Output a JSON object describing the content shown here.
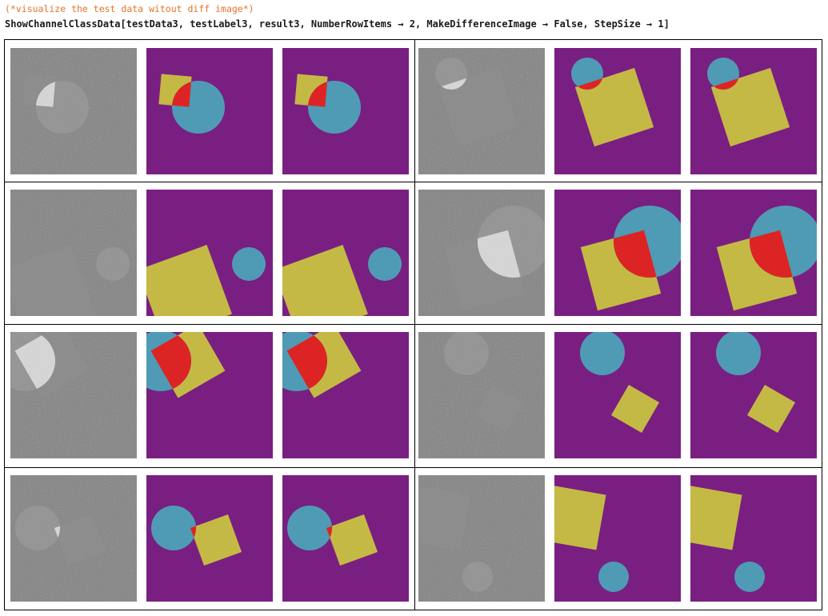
{
  "notebook": {
    "comment": "(*visualize the test data witout diff image*)",
    "code": "ShowChannelClassData[testData3, testLabel3, result3, NumberRowItems → 2, MakeDifferenceImage → False, StepSize → 1]"
  },
  "colors": {
    "background": "#7a1f82",
    "square": "#c4b944",
    "circle": "#4f9bb5",
    "overlap": "#dd2424",
    "noise_dark": "#2a2a2a",
    "gray_shape": "#8c8c8c",
    "bright_overlap": "#e0e0e0",
    "comment_color": "#e8732a"
  },
  "output_grid": {
    "rows": 4,
    "items_per_row": 2,
    "panels_per_item": [
      "input-image",
      "ground-truth-label",
      "predicted-label"
    ]
  }
}
